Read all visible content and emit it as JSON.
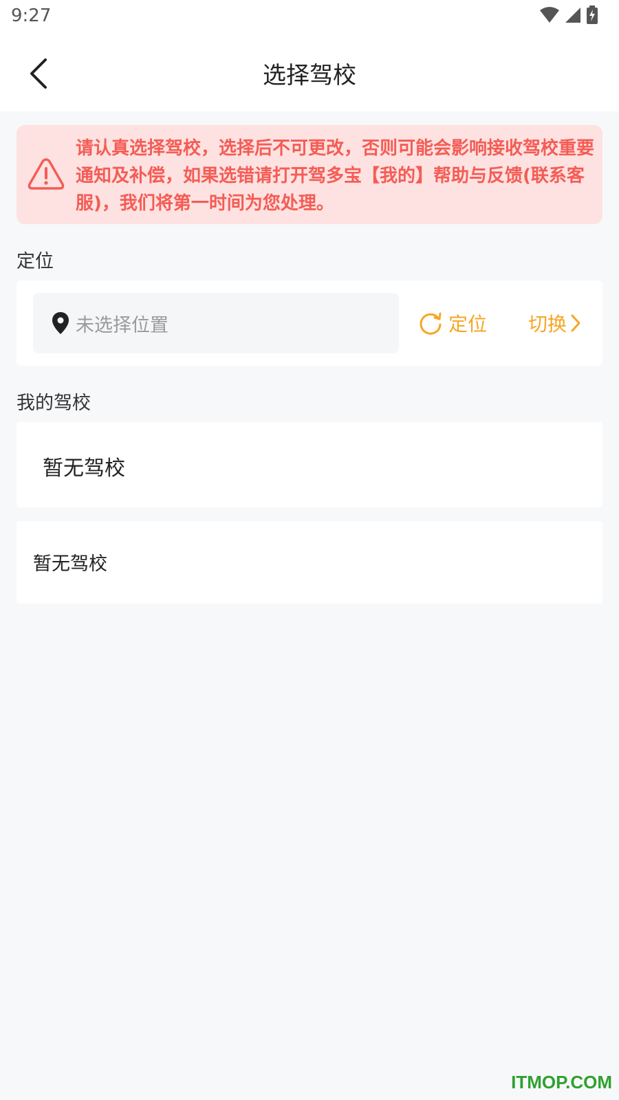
{
  "statusbar": {
    "time": "9:27"
  },
  "header": {
    "title": "选择驾校",
    "back_icon": "chevron-left-icon"
  },
  "alert": {
    "icon": "warning-icon",
    "text": "请认真选择驾校，选择后不可更改，否则可能会影响接收驾校重要通知及补偿，如果选错请打开驾多宝【我的】帮助与反馈(联系客服)，我们将第一时间为您处理。",
    "color": "#f45c55",
    "background": "#fde2e1"
  },
  "location": {
    "section_label": "定位",
    "placeholder": "未选择位置",
    "locate_label": "定位",
    "switch_label": "切换",
    "accent_color": "#f6a623"
  },
  "my_school": {
    "section_label": "我的驾校",
    "primary_empty": "暂无驾校",
    "secondary_empty": "暂无驾校"
  },
  "watermark": {
    "text": "ITMOP.COM"
  }
}
